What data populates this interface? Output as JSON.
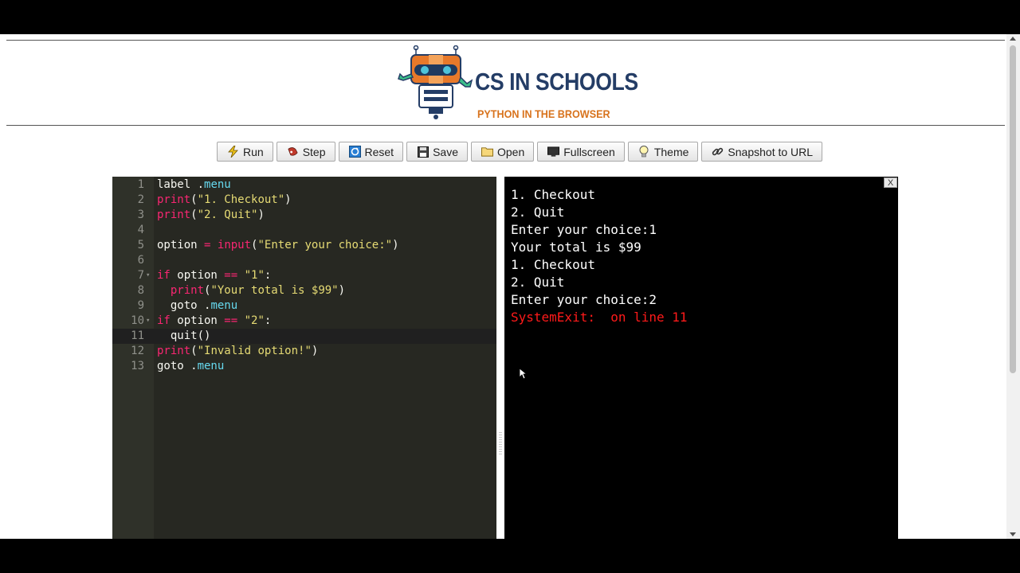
{
  "logo": {
    "title": "CS IN SCHOOLS",
    "subtitle": "PYTHON IN THE BROWSER"
  },
  "toolbar": {
    "buttons": [
      {
        "label": "Run",
        "icon": "lightning-icon"
      },
      {
        "label": "Step",
        "icon": "step-icon"
      },
      {
        "label": "Reset",
        "icon": "reset-icon"
      },
      {
        "label": "Save",
        "icon": "floppy-disk-icon"
      },
      {
        "label": "Open",
        "icon": "folder-icon"
      },
      {
        "label": "Fullscreen",
        "icon": "monitor-icon"
      },
      {
        "label": "Theme",
        "icon": "lightbulb-icon"
      },
      {
        "label": "Snapshot to URL",
        "icon": "link-icon"
      }
    ]
  },
  "editor": {
    "active_line": 11,
    "lines": [
      {
        "n": "1",
        "text": "label .menu"
      },
      {
        "n": "2",
        "text": "print(\"1. Checkout\")"
      },
      {
        "n": "3",
        "text": "print(\"2. Quit\")"
      },
      {
        "n": "4",
        "text": ""
      },
      {
        "n": "5",
        "text": "option = input(\"Enter your choice:\")"
      },
      {
        "n": "6",
        "text": ""
      },
      {
        "n": "7",
        "text": "if option == \"1\":"
      },
      {
        "n": "8",
        "text": "  print(\"Your total is $99\")"
      },
      {
        "n": "9",
        "text": "  goto .menu"
      },
      {
        "n": "10",
        "text": "if option == \"2\":"
      },
      {
        "n": "11",
        "text": "  quit()"
      },
      {
        "n": "12",
        "text": "print(\"Invalid option!\")"
      },
      {
        "n": "13",
        "text": "goto .menu"
      }
    ]
  },
  "console": {
    "close_label": "X",
    "lines": [
      "1. Checkout",
      "2. Quit",
      "Enter your choice:1",
      "Your total is $99",
      "1. Checkout",
      "2. Quit",
      "Enter your choice:2"
    ],
    "error": "SystemExit:  on line 11"
  },
  "colors": {
    "editor_bg": "#272822",
    "keyword": "#f92672",
    "function": "#66d9ef",
    "string": "#e6db74",
    "error": "#ff1a1a"
  }
}
